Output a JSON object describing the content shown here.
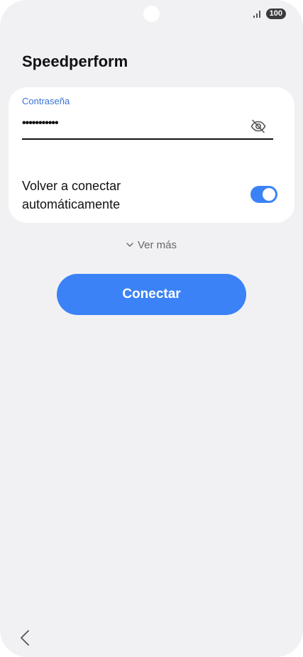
{
  "status_bar": {
    "battery": "100",
    "signal_icon": "signal-bars-icon"
  },
  "header": {
    "title": "Speedperform"
  },
  "password": {
    "label": "Contraseña",
    "masked_value": "•••••••••••",
    "toggle_visibility_icon": "eye-off-icon"
  },
  "reconnect": {
    "label": "Volver a conectar automáticamente",
    "enabled": true
  },
  "more": {
    "label": "Ver más",
    "icon": "chevron-down-icon"
  },
  "actions": {
    "connect_label": "Conectar"
  },
  "nav": {
    "back_icon": "chevron-left-icon"
  },
  "colors": {
    "accent": "#3b82f6",
    "label_blue": "#3b73d8",
    "background": "#f1f1f4"
  }
}
